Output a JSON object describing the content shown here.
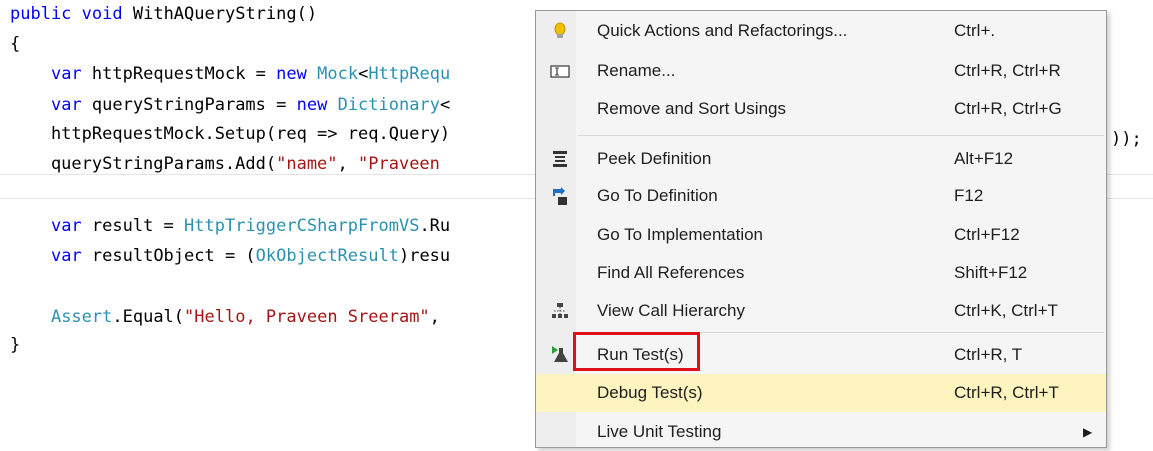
{
  "colors": {
    "keyword": "#0000ff",
    "type": "#2b91af",
    "string": "#a31515",
    "text": "#000000",
    "menu_bg": "#f5f5f5",
    "menu_highlight": "#fdf4bf",
    "callout_red": "#e0101a"
  },
  "editor": {
    "lines": [
      {
        "tokens": [
          {
            "t": "public",
            "c": "keyword"
          },
          {
            "t": " ",
            "c": "text"
          },
          {
            "t": "void",
            "c": "keyword"
          },
          {
            "t": " WithAQueryString()",
            "c": "text"
          }
        ]
      },
      {
        "tokens": [
          {
            "t": "{",
            "c": "text"
          }
        ]
      },
      {
        "tokens": [
          {
            "t": "    ",
            "c": "text"
          },
          {
            "t": "var",
            "c": "keyword"
          },
          {
            "t": " httpRequestMock = ",
            "c": "text"
          },
          {
            "t": "new",
            "c": "keyword"
          },
          {
            "t": " ",
            "c": "text"
          },
          {
            "t": "Mock",
            "c": "type"
          },
          {
            "t": "<",
            "c": "text"
          },
          {
            "t": "HttpRequ",
            "c": "type"
          }
        ]
      },
      {
        "tokens": [
          {
            "t": "    ",
            "c": "text"
          },
          {
            "t": "var",
            "c": "keyword"
          },
          {
            "t": " queryStringParams = ",
            "c": "text"
          },
          {
            "t": "new",
            "c": "keyword"
          },
          {
            "t": " ",
            "c": "text"
          },
          {
            "t": "Dictionary",
            "c": "type"
          },
          {
            "t": "<",
            "c": "text"
          }
        ]
      },
      {
        "tokens": [
          {
            "t": "    httpRequestMock.Setup(req => req.Query)",
            "c": "text"
          }
        ]
      },
      {
        "tokens": [
          {
            "t": "    queryStringParams.Add(",
            "c": "text"
          },
          {
            "t": "\"name\"",
            "c": "string"
          },
          {
            "t": ", ",
            "c": "text"
          },
          {
            "t": "\"Praveen ",
            "c": "string"
          }
        ]
      },
      {
        "tokens": []
      },
      {
        "tokens": [
          {
            "t": "    ",
            "c": "text"
          },
          {
            "t": "var",
            "c": "keyword"
          },
          {
            "t": " result = ",
            "c": "text"
          },
          {
            "t": "HttpTriggerCSharpFromVS",
            "c": "type"
          },
          {
            "t": ".Ru",
            "c": "text"
          }
        ]
      },
      {
        "tokens": [
          {
            "t": "    ",
            "c": "text"
          },
          {
            "t": "var",
            "c": "keyword"
          },
          {
            "t": " resultObject = (",
            "c": "text"
          },
          {
            "t": "OkObjectResult",
            "c": "type"
          },
          {
            "t": ")resu",
            "c": "text"
          }
        ]
      },
      {
        "tokens": []
      },
      {
        "tokens": [
          {
            "t": "    ",
            "c": "text"
          },
          {
            "t": "Assert",
            "c": "type"
          },
          {
            "t": ".Equal(",
            "c": "text"
          },
          {
            "t": "\"Hello, Praveen Sreeram\"",
            "c": "string"
          },
          {
            "t": ", ",
            "c": "text"
          }
        ]
      },
      {
        "tokens": [
          {
            "t": "}",
            "c": "text"
          }
        ]
      }
    ],
    "overflow_tail": "));"
  },
  "context_menu": {
    "items": [
      {
        "label": "Quick Actions and Refactorings...",
        "shortcut": "Ctrl+.",
        "icon": "lightbulb-icon"
      },
      {
        "label": "Rename...",
        "shortcut": "Ctrl+R, Ctrl+R",
        "icon": "rename-icon"
      },
      {
        "label": "Remove and Sort Usings",
        "shortcut": "Ctrl+R, Ctrl+G",
        "icon": ""
      },
      {
        "label": "Peek Definition",
        "shortcut": "Alt+F12",
        "icon": "peek-definition-icon"
      },
      {
        "label": "Go To Definition",
        "shortcut": "F12",
        "icon": "go-to-definition-icon"
      },
      {
        "label": "Go To Implementation",
        "shortcut": "Ctrl+F12",
        "icon": ""
      },
      {
        "label": "Find All References",
        "shortcut": "Shift+F12",
        "icon": ""
      },
      {
        "label": "View Call Hierarchy",
        "shortcut": "Ctrl+K, Ctrl+T",
        "icon": "call-hierarchy-icon"
      },
      {
        "label": "Run Test(s)",
        "shortcut": "Ctrl+R, T",
        "icon": "run-test-icon"
      },
      {
        "label": "Debug Test(s)",
        "shortcut": "Ctrl+R, Ctrl+T",
        "icon": ""
      },
      {
        "label": "Live Unit Testing",
        "shortcut": "",
        "icon": "submenu-arrow-icon"
      }
    ],
    "highlighted_item": "Debug Test(s)",
    "callout_item": "Run Test(s)"
  }
}
